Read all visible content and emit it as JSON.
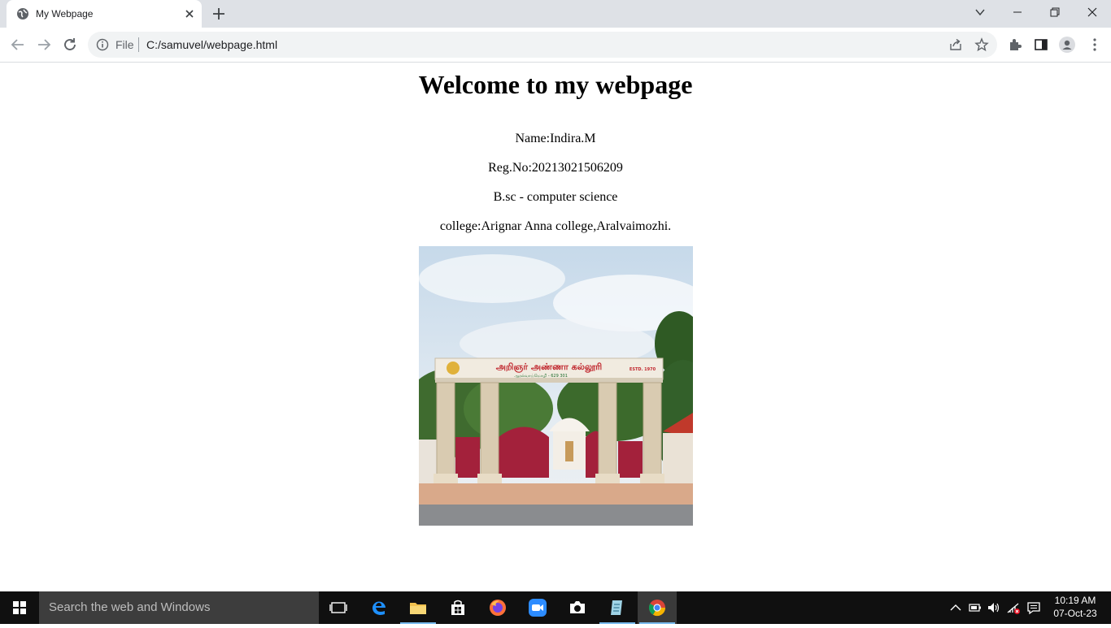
{
  "browser": {
    "tab_title": "My Webpage",
    "omnibox": {
      "scheme_label": "File",
      "url": "C:/samuvel/webpage.html"
    }
  },
  "page": {
    "heading": "Welcome to my webpage",
    "lines": {
      "name": "Name:Indira.M",
      "reg": "Reg.No:20213021506209",
      "course": "B.sc - computer science",
      "college": "college:Arignar Anna college,Aralvaimozhi."
    },
    "image": {
      "arch_sign_main": "அறிஞர் அண்ணா கல்லூரி",
      "arch_sign_sub": "ஆரல்வாய்மொழி - 629 301",
      "arch_sign_estd": "ESTD. 1970"
    }
  },
  "taskbar": {
    "search_placeholder": "Search the web and Windows",
    "apps": [
      "task-view",
      "edge",
      "file-explorer",
      "store",
      "firefox",
      "zoom",
      "camera",
      "notepad",
      "chrome"
    ],
    "clock_time": "10:19 AM",
    "clock_date": "07-Oct-23"
  },
  "colors": {
    "tabstrip": "#dee1e6",
    "omnibox": "#f1f3f4",
    "taskbar": "#101010",
    "accent": "#76b9ed"
  }
}
